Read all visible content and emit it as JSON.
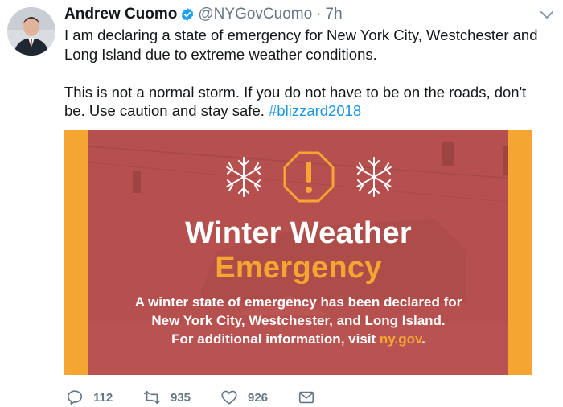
{
  "tweet": {
    "author_name": "Andrew Cuomo",
    "handle": "@NYGovCuomo",
    "separator": "·",
    "time": "7h",
    "text_line1": "I am declaring a state of emergency for New York City, Westchester and Long Island due to extreme weather conditions.",
    "text_line2_prefix": "This is not a normal storm. If you do not have to be on the roads, don't be. Use caution and stay safe. ",
    "hashtag": "#blizzard2018"
  },
  "media": {
    "headline_1": "Winter Weather",
    "headline_2": "Emergency",
    "body_line1": "A winter state of emergency has been declared for",
    "body_line2": "New York City, Westchester, and Long Island.",
    "body_line3_prefix": "For additional information, visit ",
    "body_link": "ny.gov",
    "body_line3_suffix": "."
  },
  "actions": {
    "replies": "112",
    "retweets": "935",
    "likes": "926"
  },
  "icons": {
    "verified": "verified-badge-icon",
    "chevron": "chevron-down-icon",
    "reply": "reply-icon",
    "retweet": "retweet-icon",
    "like": "heart-icon",
    "message": "envelope-icon",
    "snowflake": "snowflake-icon",
    "warning": "warning-octagon-icon"
  },
  "colors": {
    "accent_blue": "#1b95e0",
    "media_red": "#b6504f",
    "media_orange": "#f4a532",
    "muted_text": "#657786"
  }
}
